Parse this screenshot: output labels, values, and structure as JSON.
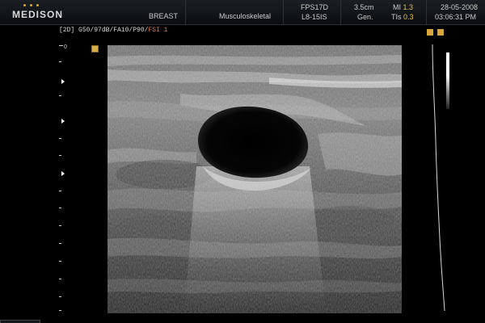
{
  "header": {
    "brand": "MEDISON",
    "preset": "BREAST",
    "application": "Musculoskeletal",
    "probe_freq_label": "FPS17D",
    "probe_label": "L8-15IS",
    "depth": "3.5cm",
    "mode": "Gen.",
    "mi_label": "MI",
    "mi_value": "1.3",
    "tis_label": "TIs",
    "tis_value": "0.3",
    "date": "28-05-2008",
    "time": "03:06:31 PM"
  },
  "imaging_params": {
    "prefix": "[2D]",
    "values": "G50/97dB/FA10/P90/",
    "fsi": "FSI 1"
  },
  "depth_scale": {
    "zero_label": "0"
  },
  "colors": {
    "brand_dot": "#d7a91f",
    "value_highlight": "#e8c33a",
    "fsi_accent": "#e07a3a",
    "background": "#000000"
  }
}
